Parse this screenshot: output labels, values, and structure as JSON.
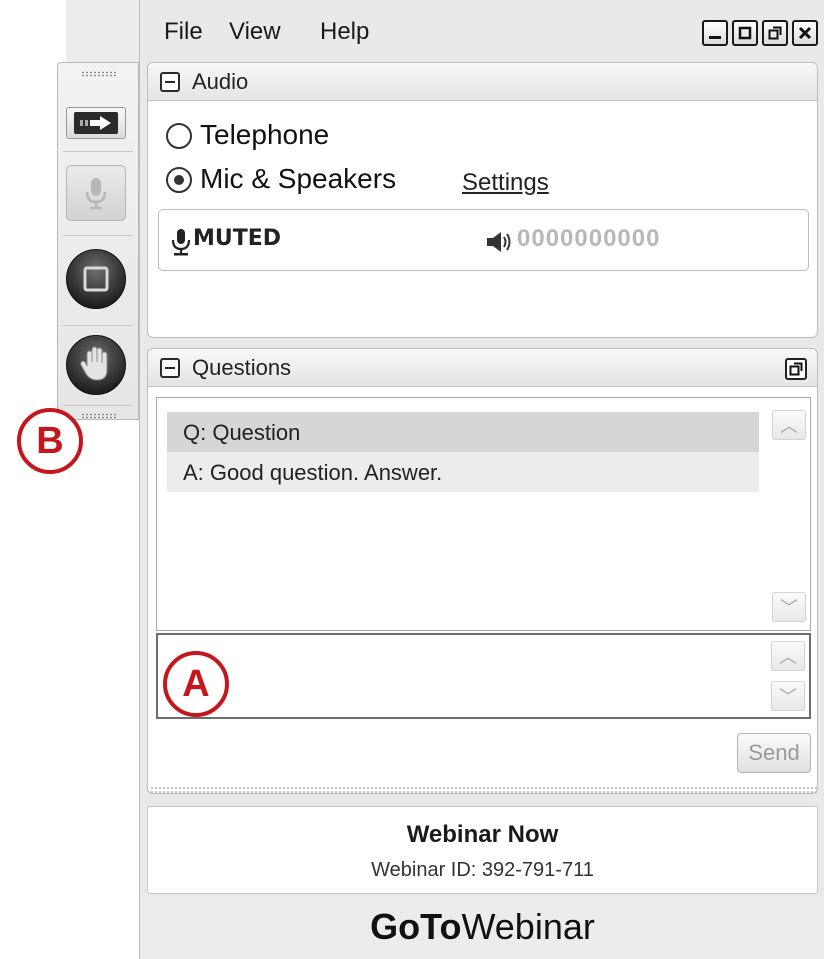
{
  "menu": {
    "file": "File",
    "view": "View",
    "help": "Help"
  },
  "window_buttons": [
    {
      "name": "minimize",
      "icon": "minimize-icon"
    },
    {
      "name": "maximize",
      "icon": "maximize-icon"
    },
    {
      "name": "restore",
      "icon": "restore-icon"
    },
    {
      "name": "close",
      "icon": "close-icon"
    }
  ],
  "audio": {
    "title": "Audio",
    "option_telephone": "Telephone",
    "option_mic": "Mic & Speakers",
    "selected": "Mic & Speakers",
    "settings_link": "Settings",
    "mic_status": "MUTED",
    "speaker_level": "0000000000"
  },
  "questions": {
    "title": "Questions",
    "items": [
      {
        "text": "Q: Question"
      },
      {
        "text": "A: Good question. Answer."
      }
    ],
    "input_value": "",
    "send_label": "Send"
  },
  "webinar": {
    "name": "Webinar Now",
    "id_text": "Webinar ID: 392-791-711"
  },
  "brand": {
    "bold": "GoTo",
    "regular": "Webinar"
  },
  "annotations": {
    "a": "A",
    "b": "B"
  },
  "colors": {
    "annotation_red": "#c4161c"
  }
}
